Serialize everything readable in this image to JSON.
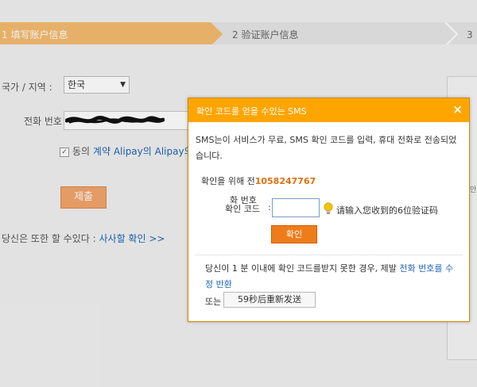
{
  "steps": [
    {
      "label": "1 填写账户信息"
    },
    {
      "label": "2 验证账户信息"
    },
    {
      "label": "3 ："
    }
  ],
  "form": {
    "region_label": "국가 / 지역 :",
    "region_value": "한국",
    "phone_label": "전화 번호",
    "agree_prefix": "동의",
    "agree_link": "계약 Alipay의",
    "agree_suffix": "Alipay의",
    "submit_label": "제출",
    "also_text": "당신은 또한 할 수있다 :",
    "also_link": "사사할 확인 >>"
  },
  "right_fragment": "안",
  "dialog": {
    "title": "확인 코드를 얻을 수있는 SMS",
    "close": "×",
    "description": "SMS는이 서비스가 무료, SMS 확인 코드를 입력, 휴대 전화로 전송되었습니다.",
    "confirm_prefix": "확인을 위해 전",
    "phone_number": "1058247767",
    "code_label_top": "화 번호",
    "code_label": "확인 코드",
    "code_colon": ":",
    "code_value": "",
    "hint": "请输入您收到的6位验证码",
    "confirm_button": "확인",
    "note_text": "당신이 1 분 이내에 확인 코드를받지 못한 경우, 제발",
    "note_link": "전화 번호를 수정 반환",
    "or_text": "또는",
    "resend_button": "59秒后重新发送"
  },
  "colors": {
    "dialog_header": "#ffa500",
    "phone_number": "#e0700c",
    "confirm_button": "#ef7c1a",
    "step_active": "#f5bc6f"
  }
}
